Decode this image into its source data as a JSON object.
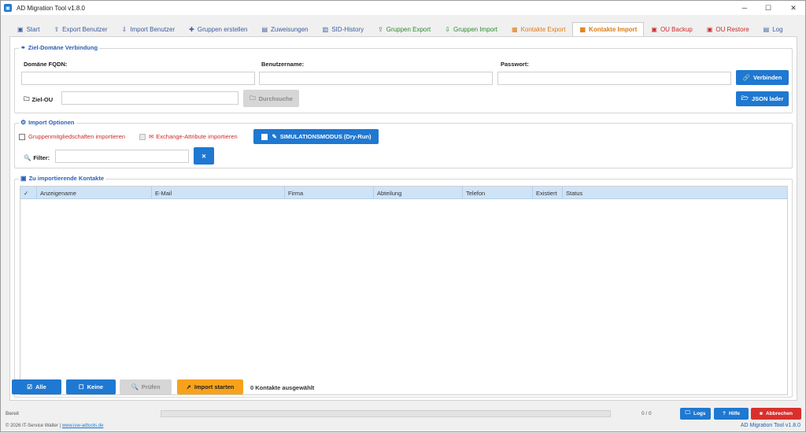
{
  "window": {
    "title": "AD Migration Tool v1.8.0",
    "minimize": "─",
    "maximize": "☐",
    "close": "✕"
  },
  "tabs": [
    {
      "label": "Start",
      "icon": "▣",
      "color": "c-blue"
    },
    {
      "label": "Export Benutzer",
      "icon": "⇪",
      "color": "c-blue"
    },
    {
      "label": "Import Benutzer",
      "icon": "⇩",
      "color": "c-blue"
    },
    {
      "label": "Gruppen erstellen",
      "icon": "✚",
      "color": "c-blue"
    },
    {
      "label": "Zuweisungen",
      "icon": "▤",
      "color": "c-blue"
    },
    {
      "label": "SID-History",
      "icon": "▥",
      "color": "c-blue"
    },
    {
      "label": "Gruppen Export",
      "icon": "⇪",
      "color": "c-green"
    },
    {
      "label": "Gruppen Import",
      "icon": "⇩",
      "color": "c-green"
    },
    {
      "label": "Kontakte Export",
      "icon": "▦",
      "color": "c-orange"
    },
    {
      "label": "Kontakte Import",
      "icon": "▦",
      "color": "c-orange"
    },
    {
      "label": "OU Backup",
      "icon": "▣",
      "color": "c-red"
    },
    {
      "label": "OU Restore",
      "icon": "▣",
      "color": "c-red"
    },
    {
      "label": "Log",
      "icon": "▤",
      "color": "c-blue"
    }
  ],
  "active_tab": "Kontakte Import",
  "ziel": {
    "title": "Ziel-Domäne Verbindung",
    "domain_label": "Domäne FQDN:",
    "domain_value": "",
    "user_label": "Benutzername:",
    "user_value": "",
    "pass_label": "Passwort:",
    "pass_value": "",
    "connect_button": "Verbinden",
    "ou_label": "Ziel-OU",
    "ou_value": "",
    "browse_button": "Durchsuche",
    "json_button": "JSON lader"
  },
  "import_options": {
    "title": "Import Optionen",
    "groups_checkbox": "Gruppenmitgliedschaften importieren",
    "exchange_checkbox": "Exchange-Attribute importieren",
    "simulation_button": "SIMULATIONSMODUS (Dry-Run)",
    "filter_label": "Filter:",
    "filter_value": "",
    "clear_button": "✕"
  },
  "contacts": {
    "title": "Zu importierende Kontakte",
    "columns": [
      "✓",
      "Anzeigename",
      "E-Mail",
      "Firma",
      "Abteilung",
      "Telefon",
      "Existiert",
      "Status"
    ],
    "rows": []
  },
  "actions": {
    "all_button": "Alle",
    "none_button": "Keine",
    "check_button": "Prüfen",
    "start_button": "Import starten",
    "selected_text": "0 Kontakte ausgewählt"
  },
  "status": {
    "state": "Bereit",
    "progress": 0,
    "count": "0 / 0",
    "log_button": "Logs",
    "help_button": "Hilfe",
    "cancel_button": "Abbrechen",
    "copyright": "© 2026 IT-Service Walter | ",
    "link": "www.isw-adtools.de",
    "version": "AD Migration Tool v1.8.0"
  },
  "colors": {
    "accent": "#1f78d1",
    "warning": "#f7a21b",
    "danger": "#d9302c",
    "header": "#cfe3f7"
  }
}
